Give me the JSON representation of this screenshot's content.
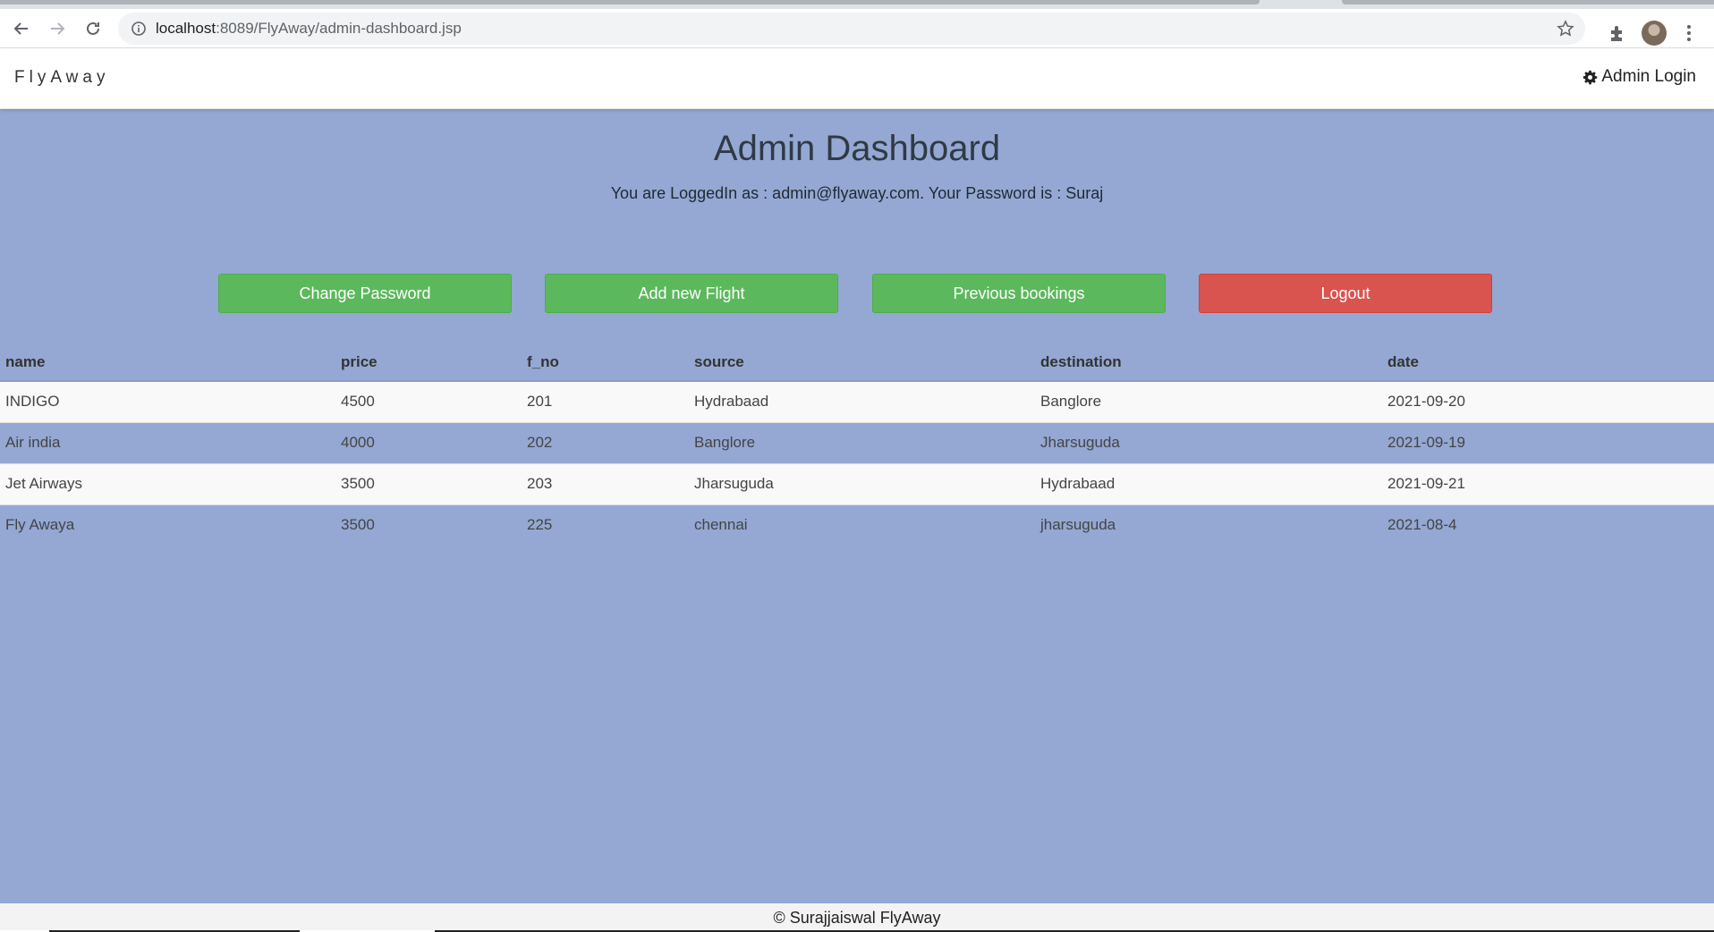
{
  "browser": {
    "url_host": "localhost",
    "url_path": ":8089/FlyAway/admin-dashboard.jsp"
  },
  "navbar": {
    "brand": "FlyAway",
    "admin_login": "Admin Login"
  },
  "dashboard": {
    "title": "Admin Dashboard",
    "subtitle": "You are LoggedIn as : admin@flyaway.com. Your Password is : Suraj",
    "buttons": {
      "change_password": "Change Password",
      "add_flight": "Add new Flight",
      "previous_bookings": "Previous bookings",
      "logout": "Logout"
    }
  },
  "table": {
    "headers": [
      "name",
      "price",
      "f_no",
      "source",
      "destination",
      "date"
    ],
    "rows": [
      [
        "INDIGO",
        "4500",
        "201",
        "Hydrabaad",
        "Banglore",
        "2021-09-20"
      ],
      [
        "Air india",
        "4000",
        "202",
        "Banglore",
        "Jharsuguda",
        "2021-09-19"
      ],
      [
        "Jet Airways",
        "3500",
        "203",
        "Jharsuguda",
        "Hydrabaad",
        "2021-09-21"
      ],
      [
        "Fly Awaya",
        "3500",
        "225",
        "chennai",
        "jharsuguda",
        "2021-08-4"
      ]
    ]
  },
  "footer": {
    "text": "© Surajjaiswal FlyAway"
  },
  "colors": {
    "page_background": "#94a8d3",
    "button_green": "#5cb85c",
    "button_red": "#d9534f"
  }
}
